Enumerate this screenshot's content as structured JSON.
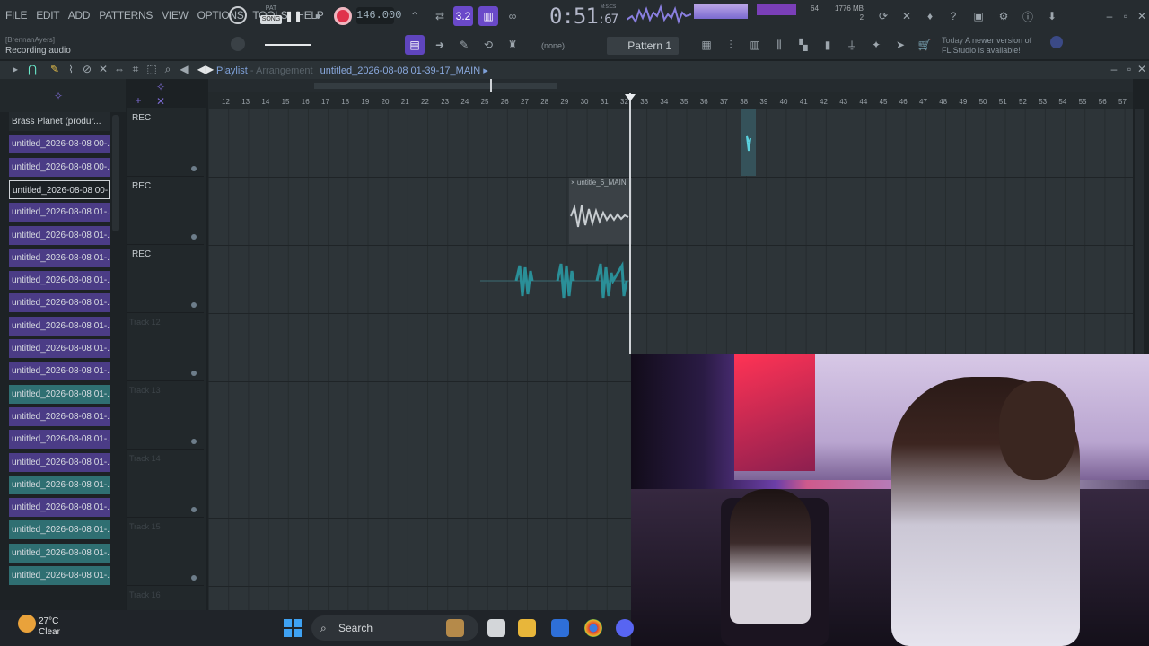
{
  "menu": [
    "FILE",
    "EDIT",
    "ADD",
    "PATTERNS",
    "VIEW",
    "OPTIONS",
    "TOOLS",
    "HELP"
  ],
  "transport": {
    "pat_label": "PAT",
    "song_label": "SONG",
    "tempo": "146.000"
  },
  "clock": {
    "main": "0:51",
    "sub": "67",
    "unit": "M:S:CS"
  },
  "monitor": {
    "cpu": "64",
    "mem": "1776 MB",
    "voices": "2"
  },
  "hint": {
    "line1_prefix": "Today",
    "line1": "A newer version of",
    "line2": "FL Studio is available!"
  },
  "status": {
    "user": "[BrennanAyers]",
    "recording": "Recording audio"
  },
  "pattern": {
    "name": "Pattern 1",
    "snap": "(none)"
  },
  "playlist": {
    "title": "Playlist",
    "sep": "- Arrangement",
    "file": "untitled_2026-08-08 01-39-17_MAIN"
  },
  "browser": {
    "items": [
      {
        "label": "Brass Planet (produr...",
        "style": "brass"
      },
      {
        "label": "untitled_2026-08-08 00-...",
        "style": "purple"
      },
      {
        "label": "untitled_2026-08-08 00-...",
        "style": "purple"
      },
      {
        "label": "untitled_2026-08-08 00-...",
        "style": "sel"
      },
      {
        "label": "untitled_2026-08-08 01-...",
        "style": "purple"
      },
      {
        "label": "untitled_2026-08-08 01-...",
        "style": "purple"
      },
      {
        "label": "untitled_2026-08-08 01-...",
        "style": "purple"
      },
      {
        "label": "untitled_2026-08-08 01-...",
        "style": "purple"
      },
      {
        "label": "untitled_2026-08-08 01-...",
        "style": "purple"
      },
      {
        "label": "untitled_2026-08-08 01-...",
        "style": "purple"
      },
      {
        "label": "untitled_2026-08-08 01-...",
        "style": "purple"
      },
      {
        "label": "untitled_2026-08-08 01-...",
        "style": "purple"
      },
      {
        "label": "untitled_2026-08-08 01-...",
        "style": "teal"
      },
      {
        "label": "untitled_2026-08-08 01-...",
        "style": "purple"
      },
      {
        "label": "untitled_2026-08-08 01-...",
        "style": "purple"
      },
      {
        "label": "untitled_2026-08-08 01-...",
        "style": "purple"
      },
      {
        "label": "untitled_2026-08-08 01-...",
        "style": "teal"
      },
      {
        "label": "untitled_2026-08-08 01-...",
        "style": "purple"
      },
      {
        "label": "untitled_2026-08-08 01-...",
        "style": "teal"
      },
      {
        "label": "untitled_2026-08-08 01-...",
        "style": "teal"
      },
      {
        "label": "untitled_2026-08-08 01-...",
        "style": "teal"
      }
    ]
  },
  "tracks": [
    {
      "label": "REC",
      "kind": "rec"
    },
    {
      "label": "REC",
      "kind": "rec"
    },
    {
      "label": "REC",
      "kind": "rec"
    },
    {
      "label": "Track 12",
      "kind": "dim"
    },
    {
      "label": "Track 13",
      "kind": "dim"
    },
    {
      "label": "Track 14",
      "kind": "dim"
    },
    {
      "label": "Track 15",
      "kind": "dim"
    },
    {
      "label": "Track 16",
      "kind": "dim"
    }
  ],
  "ruler": [
    "12",
    "13",
    "14",
    "15",
    "16",
    "17",
    "18",
    "19",
    "20",
    "21",
    "22",
    "23",
    "24",
    "25",
    "26",
    "27",
    "28",
    "29",
    "30",
    "31",
    "32",
    "33",
    "34",
    "35",
    "36",
    "37",
    "38",
    "39",
    "40",
    "41",
    "42",
    "43",
    "44",
    "45",
    "46",
    "47",
    "48",
    "49",
    "50",
    "51",
    "52",
    "53",
    "54",
    "55",
    "56",
    "57"
  ],
  "clip": {
    "label": "untitle_6_MAIN"
  },
  "taskbar": {
    "temp": "27°C",
    "weather": "Clear",
    "search": "Search"
  },
  "colors": {
    "accent": "#7b5cf0",
    "clip_teal": "#2f6f72",
    "clip_purple": "#4b3c86",
    "record": "#e0324b"
  }
}
